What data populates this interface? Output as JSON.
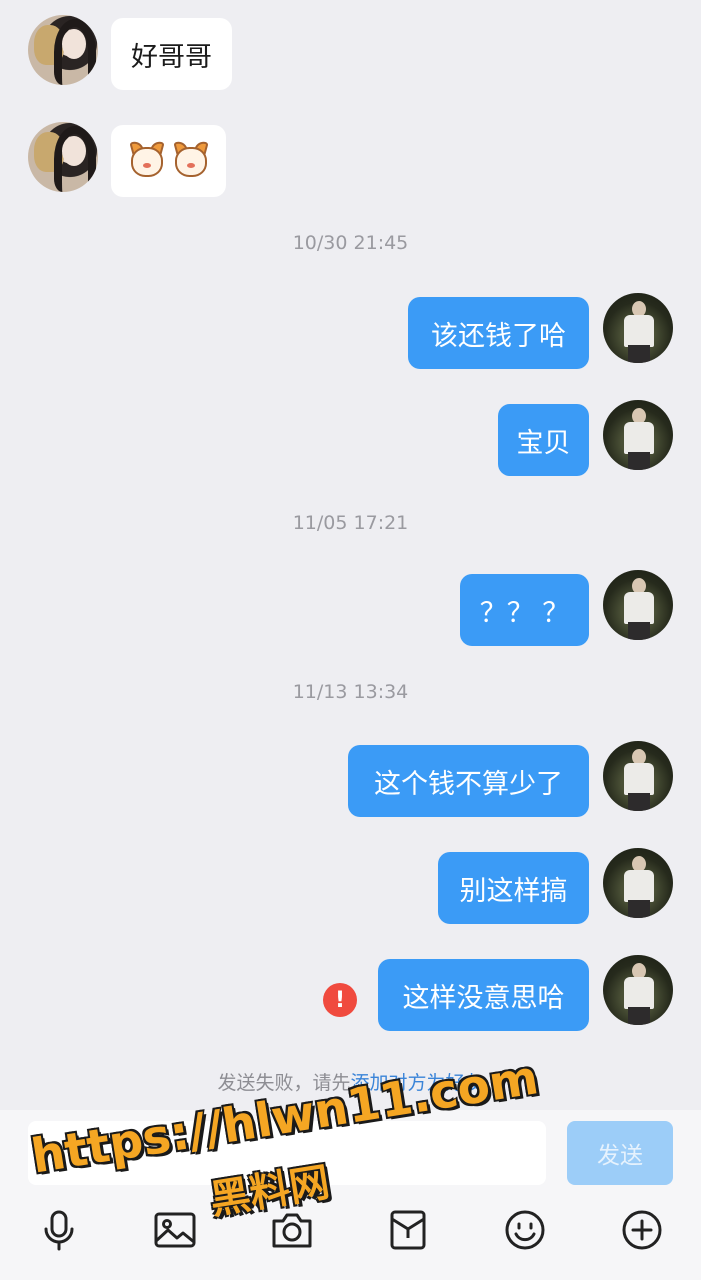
{
  "messages": {
    "in1": "好哥哥",
    "in2_emoji": "cat-face-emoji",
    "ts1": "10/30 21:45",
    "out1": "该还钱了哈",
    "out2": "宝贝",
    "ts2": "11/05 17:21",
    "out3": "？？ ？",
    "ts3": "11/13 13:34",
    "out4": "这个钱不算少了",
    "out5": "别这样搞",
    "out6": "这样没意思哈"
  },
  "notice": {
    "prefix": "发送失败，请先",
    "link": "添加对方为好友"
  },
  "input": {
    "value": "",
    "send_label": "发送"
  },
  "toolbar": [
    "mic-icon",
    "image-icon",
    "camera-icon",
    "envelope-icon",
    "smiley-icon",
    "plus-icon"
  ],
  "watermark": {
    "line1": "https://hlwn11.com",
    "line2": "黑料网"
  },
  "colors": {
    "outgoing_bubble": "#3b9bf6",
    "incoming_bubble": "#ffffff",
    "background": "#eeeef2",
    "error": "#f04a3e",
    "link": "#3a84d8"
  }
}
